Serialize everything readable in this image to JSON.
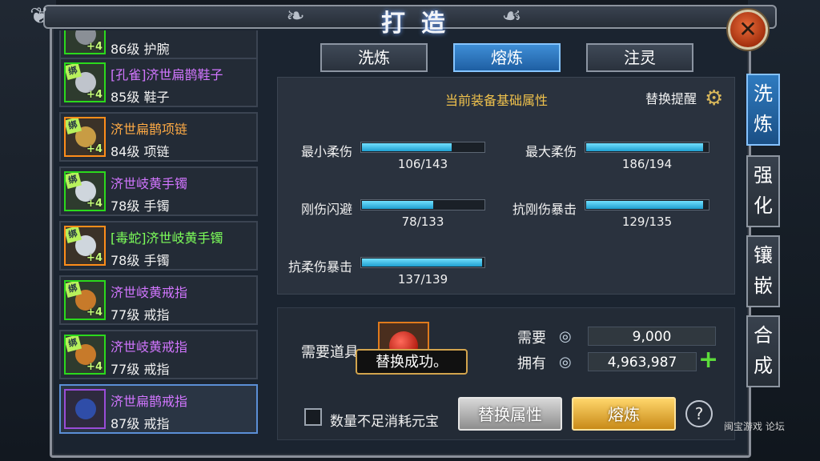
{
  "title": "打造",
  "close_icon": "close-icon",
  "items": [
    {
      "name": "",
      "level": "86级 护腕",
      "plus": "+4",
      "rarity": "green",
      "bind": ""
    },
    {
      "name": "[孔雀]济世扁鹊鞋子",
      "level": "85级 鞋子",
      "plus": "+4",
      "rarity": "green",
      "bind": "绑"
    },
    {
      "name": "济世扁鹊项链",
      "level": "84级 项链",
      "plus": "+4",
      "rarity": "orange",
      "bind": "绑"
    },
    {
      "name": "济世岐黄手镯",
      "level": "78级 手镯",
      "plus": "+4",
      "rarity": "green",
      "bind": "绑"
    },
    {
      "name": "[毒蛇]济世岐黄手镯",
      "level": "78级 手镯",
      "plus": "+4",
      "rarity": "orange",
      "bind": "绑"
    },
    {
      "name": "济世岐黄戒指",
      "level": "77级 戒指",
      "plus": "+4",
      "rarity": "green",
      "bind": "绑"
    },
    {
      "name": "济世岐黄戒指",
      "level": "77级 戒指",
      "plus": "+4",
      "rarity": "green",
      "bind": "绑"
    },
    {
      "name": "济世扁鹊戒指",
      "level": "87级 戒指",
      "plus": "",
      "rarity": "purple",
      "bind": ""
    }
  ],
  "tabs": [
    "洗炼",
    "熔炼",
    "注灵"
  ],
  "active_tab": "熔炼",
  "panel_title": "当前装备基础属性",
  "remind_label": "替换提醒",
  "attributes": [
    {
      "label": "最小柔伤",
      "value": "106/143",
      "fill": 0.74
    },
    {
      "label": "最大柔伤",
      "value": "186/194",
      "fill": 0.96
    },
    {
      "label": "刚伤闪避",
      "value": "78/133",
      "fill": 0.59
    },
    {
      "label": "抗刚伤暴击",
      "value": "129/135",
      "fill": 0.96
    },
    {
      "label": "抗柔伤暴击",
      "value": "137/139",
      "fill": 0.99
    }
  ],
  "need_item_label": "需要道具",
  "toast": "替换成功。",
  "cost": {
    "need_label": "需要",
    "need_value": "9,000",
    "have_label": "拥有",
    "have_value": "4,963,987"
  },
  "checkbox_label": "数量不足消耗元宝",
  "btn_replace": "替换属性",
  "btn_smelt": "熔炼",
  "help": "?",
  "side_tabs": [
    "洗炼",
    "强化",
    "镶嵌",
    "合成"
  ],
  "watermark": "闽宝游戏 论坛"
}
